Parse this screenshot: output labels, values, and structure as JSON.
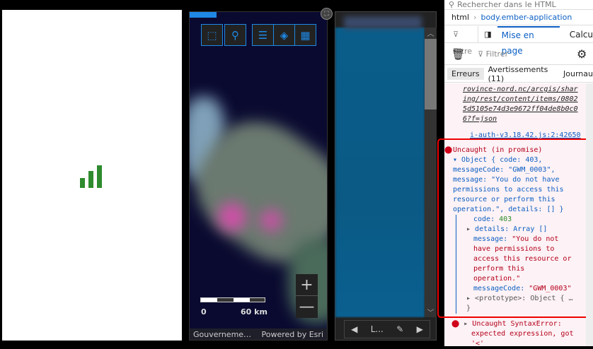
{
  "map": {
    "scale_zero": "0",
    "scale_label": "60 km",
    "attribution_left": "Gouverneme…",
    "attribution_right": "Powered by Esri",
    "zoom_in": "+",
    "zoom_out": "—"
  },
  "list": {
    "footer_label": "L..."
  },
  "devtools": {
    "search_placeholder": "Rechercher dans le HTML",
    "breadcrumb": [
      "html",
      "body.ember-application"
    ],
    "filter_rules": "Filtre",
    "tab_layout": "Mise en page",
    "tab_computed": "Calcu",
    "console_filter": "Filtrer",
    "tabs": [
      "Erreurs",
      "Avertissements (11)",
      "Journau"
    ],
    "url_lines": [
      "rovince-nord.nc/arcgis/shar",
      "ing/rest/content/items/0802",
      "5d5105e74d3e9672ff04de8b0c0",
      "6?f=json"
    ],
    "source": "i-auth-v3.18.42.js:2:42650",
    "error1": {
      "title": "Uncaught (in promise)",
      "summary": [
        "Object { code: 403,",
        "messageCode: \"GWM_0003\",",
        "message: \"You do not have",
        "permissions to access this",
        "resource or perform this",
        "operation.\", details: [] }"
      ],
      "code_key": "code:",
      "code_val": "403",
      "details_key": "details:",
      "details_val": "Array []",
      "message_key": "message:",
      "message_val": [
        "\"You do not",
        "have permissions to",
        "access this resource or",
        "perform this",
        "operation.\""
      ],
      "msgcode_key": "messageCode:",
      "msgcode_val": "\"GWM_0003\"",
      "prototype": "<prototype>: Object { …",
      "close": "}"
    },
    "error2": [
      "Uncaught SyntaxError:",
      "expected expression, got",
      "'<'"
    ]
  }
}
